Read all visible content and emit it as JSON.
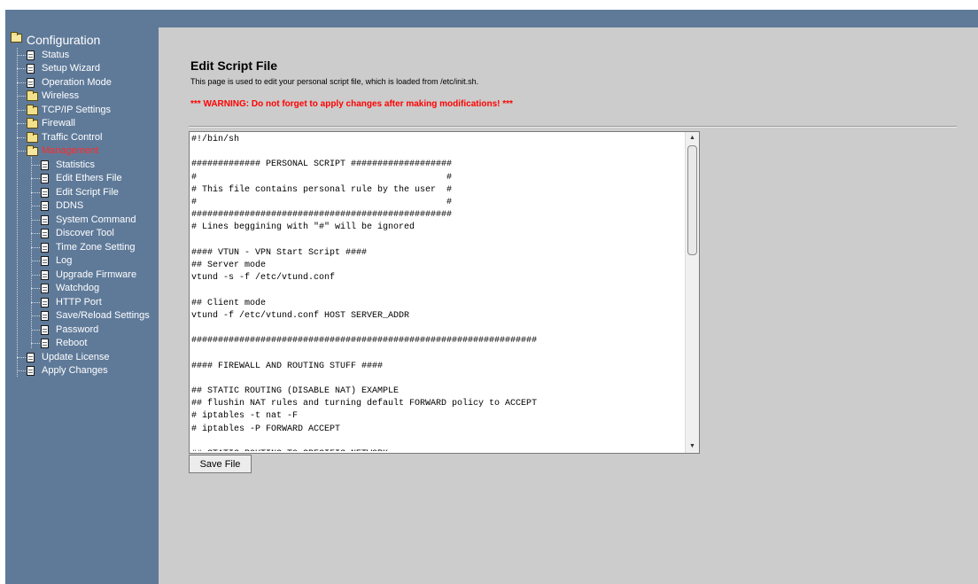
{
  "sidebar": {
    "root_label": "Configuration",
    "items": [
      {
        "label": "Status"
      },
      {
        "label": "Setup Wizard"
      },
      {
        "label": "Operation Mode"
      },
      {
        "label": "Wireless"
      },
      {
        "label": "TCP/IP Settings"
      },
      {
        "label": "Firewall"
      },
      {
        "label": "Traffic Control"
      },
      {
        "label": "Management"
      },
      {
        "label": "Statistics"
      },
      {
        "label": "Edit Ethers File"
      },
      {
        "label": "Edit Script File"
      },
      {
        "label": "DDNS"
      },
      {
        "label": "System Command"
      },
      {
        "label": "Discover Tool"
      },
      {
        "label": "Time Zone Setting"
      },
      {
        "label": "Log"
      },
      {
        "label": "Upgrade Firmware"
      },
      {
        "label": "Watchdog"
      },
      {
        "label": "HTTP Port"
      },
      {
        "label": "Save/Reload Settings"
      },
      {
        "label": "Password"
      },
      {
        "label": "Reboot"
      },
      {
        "label": "Update License"
      },
      {
        "label": "Apply Changes"
      }
    ]
  },
  "page": {
    "title": "Edit Script File",
    "description": "This page is used to edit your personal script file, which is loaded from /etc/init.sh.",
    "warning": "*** WARNING: Do not forget to apply changes after making modifications! ***"
  },
  "editor": {
    "content": "#!/bin/sh\n\n############# PERSONAL SCRIPT ###################\n#                                               #\n# This file contains personal rule by the user  #\n#                                               #\n#################################################\n# Lines beggining with \"#\" will be ignored\n\n#### VTUN - VPN Start Script ####\n## Server mode\nvtund -s -f /etc/vtund.conf\n\n## Client mode\nvtund -f /etc/vtund.conf HOST SERVER_ADDR\n\n#################################################################\n\n#### FIREWALL AND ROUTING STUFF ####\n\n## STATIC ROUTING (DISABLE NAT) EXAMPLE\n## flushin NAT rules and turning default FORWARD policy to ACCEPT\n# iptables -t nat -F\n# iptables -P FORWARD ACCEPT\n\n## STATIC ROUTING TO SPECIFIC NETWORK"
  },
  "actions": {
    "save_label": "Save File"
  },
  "colors": {
    "sidebar_bg": "#5f7a99",
    "main_bg": "#cccccc",
    "active_item": "#ff2a2a",
    "warning": "#ff0000"
  }
}
